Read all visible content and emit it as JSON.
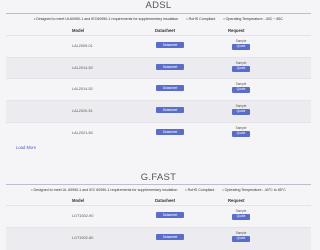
{
  "adsl": {
    "title": "ADSL",
    "features": [
      "Designed to meet UL60950-1 and IEC60950-1 requirements for supplementary insulation",
      "RoHS Compliant",
      "Operating Temperature: -40C ~ 85C"
    ],
    "columns": {
      "model": "Model",
      "datasheet": "Datasheet",
      "request": "Request"
    },
    "rows": [
      {
        "model": "LAL2009-01",
        "datasheet": "Datasheet",
        "sample": "Sample",
        "quote": "Quote"
      },
      {
        "model": "LAL2014-50",
        "datasheet": "Datasheet",
        "sample": "Sample",
        "quote": "Quote"
      },
      {
        "model": "LAL2014-52",
        "datasheet": "Datasheet",
        "sample": "Sample",
        "quote": "Quote"
      },
      {
        "model": "LAL2020-51",
        "datasheet": "Datasheet",
        "sample": "Sample",
        "quote": "Quote"
      },
      {
        "model": "LAL2021-50",
        "datasheet": "Datasheet",
        "sample": "Sample",
        "quote": "Quote"
      }
    ],
    "load_more": "Load More"
  },
  "gfast": {
    "title": "G.FAST",
    "features": [
      "Designed to meet UL 60950-1 and IEC 60950-1 requirements for supplementary insulation",
      "RoHS Compliant",
      "Operating Temperature: -40°C to 85°C"
    ],
    "columns": {
      "model": "Model",
      "datasheet": "Datasheet",
      "request": "Request"
    },
    "rows": [
      {
        "model": "LGT1502-90",
        "datasheet": "Datasheet",
        "sample": "Sample",
        "quote": "Quote"
      },
      {
        "model": "LGT1502-80",
        "datasheet": "Datasheet",
        "sample": "Sample",
        "quote": "Quote"
      }
    ]
  },
  "colors": {
    "accent": "#5a6ec9",
    "rule": "#b9bfd0",
    "background": "#f5f5f7"
  }
}
